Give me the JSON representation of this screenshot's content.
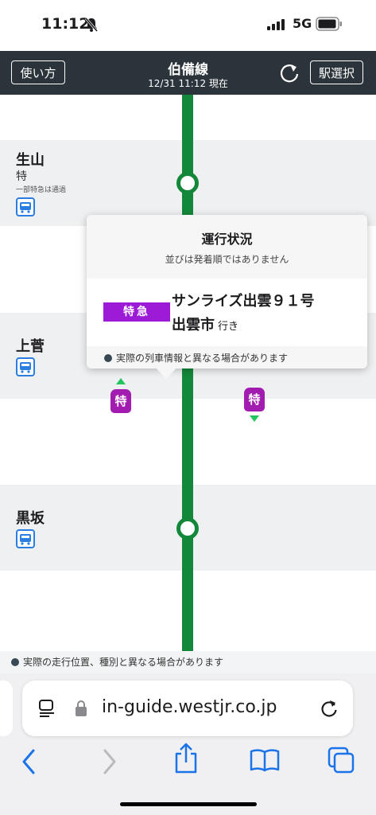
{
  "status_bar": {
    "time": "11:12",
    "network": "5G",
    "bell_icon": "bell-slash-icon",
    "signal_icon": "signal-bars-icon",
    "battery_icon": "battery-icon"
  },
  "header": {
    "howto_label": "使い方",
    "line_name": "伯備線",
    "updated": "12/31 11:12 現在",
    "station_select_label": "駅選択",
    "refresh_icon": "refresh-icon",
    "bg_color": "#2b343a"
  },
  "stations": [
    {
      "name": "生山",
      "type": "特",
      "note": "一部特急は通過",
      "icon": "bus-icon"
    },
    {
      "name": "上菅",
      "icon": "bus-icon"
    },
    {
      "name": "黒坂",
      "icon": "bus-icon"
    }
  ],
  "trains": [
    {
      "label": "特",
      "direction": "up"
    },
    {
      "label": "特",
      "direction": "down"
    }
  ],
  "popup": {
    "title": "運行状況",
    "subtitle": "並びは発着順ではありません",
    "badge": "特急",
    "train_name": "サンライズ出雲９１号",
    "destination": "出雲市",
    "destination_suffix": "行き",
    "note": "実際の列車情報と異なる場合があります"
  },
  "disclaimer": "実際の走行位置、種別と異なる場合があります",
  "browser": {
    "url": "in-guide.westjr.co.jp",
    "icons": [
      "tabs-format-icon",
      "lock-icon",
      "reload-icon",
      "back-icon",
      "forward-icon",
      "share-icon",
      "bookmarks-icon",
      "tabs-icon"
    ]
  },
  "colors": {
    "line_green": "#14883a",
    "limited_express": "#a21caf",
    "accent_blue": "#1a73e8"
  }
}
